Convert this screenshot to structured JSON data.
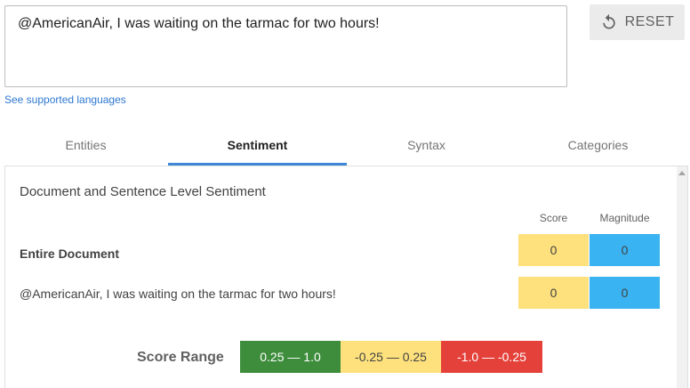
{
  "input": {
    "text": "@AmericanAir, I was waiting on the tarmac for two hours!"
  },
  "reset": {
    "label": "RESET",
    "icon": "refresh-icon"
  },
  "languages_link": "See supported languages",
  "tabs": [
    {
      "label": "Entities"
    },
    {
      "label": "Sentiment",
      "active": true
    },
    {
      "label": "Syntax"
    },
    {
      "label": "Categories"
    }
  ],
  "sentiment": {
    "section_title": "Document and Sentence Level Sentiment",
    "columns": {
      "score": "Score",
      "magnitude": "Magnitude"
    },
    "rows": [
      {
        "label": "Entire Document",
        "score": "0",
        "magnitude": "0"
      },
      {
        "label": "@AmericanAir, I was waiting on the tarmac for two hours!",
        "score": "0",
        "magnitude": "0"
      }
    ],
    "range": {
      "label": "Score Range",
      "segments": [
        {
          "label": "0.25 — 1.0",
          "color": "#3e8d3c"
        },
        {
          "label": "-0.25 — 0.25",
          "color": "#fee17d"
        },
        {
          "label": "-1.0 — -0.25",
          "color": "#e5413b"
        }
      ]
    }
  },
  "colors": {
    "accent": "#3e86d6",
    "score_cell": "#fee17d",
    "magnitude_cell": "#3ab3f2"
  }
}
